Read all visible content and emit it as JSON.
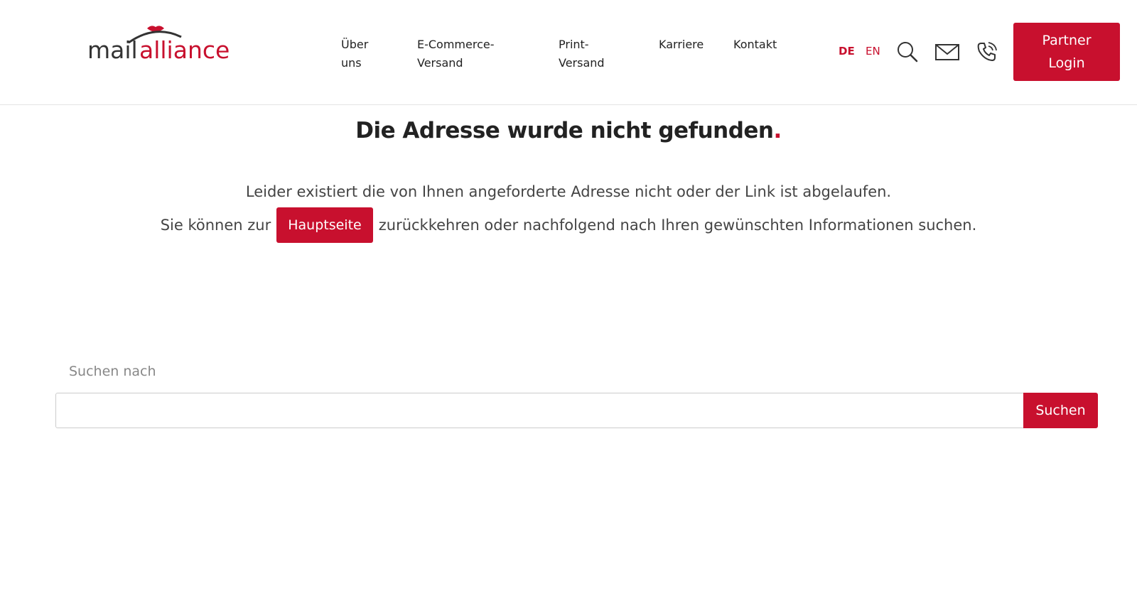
{
  "header": {
    "logo": {
      "part1": "mail",
      "part2": "alliance"
    },
    "nav": [
      {
        "label": "Über uns"
      },
      {
        "label": "E-Commerce-Versand"
      },
      {
        "label": "Print-Versand"
      },
      {
        "label": "Karriere"
      },
      {
        "label": "Kontakt"
      }
    ],
    "languages": {
      "active": "DE",
      "other": "EN"
    },
    "icons": {
      "search": "search-icon",
      "mail": "mail-icon",
      "phone": "phone-icon"
    },
    "partner_login_label": "Partner Login"
  },
  "main": {
    "title": "Die Adresse wurde nicht gefunden",
    "title_dot": ".",
    "line1": "Leider existiert die von Ihnen angeforderte Adresse nicht oder der Link ist abgelaufen.",
    "line2_before": "Sie können zur",
    "home_button_label": "Hauptseite",
    "line2_after": "zurückkehren oder nachfolgend nach Ihren gewünschten Informationen suchen."
  },
  "search": {
    "label": "Suchen nach",
    "value": "",
    "button_label": "Suchen"
  },
  "colors": {
    "accent": "#c8102e",
    "text": "#333333"
  }
}
